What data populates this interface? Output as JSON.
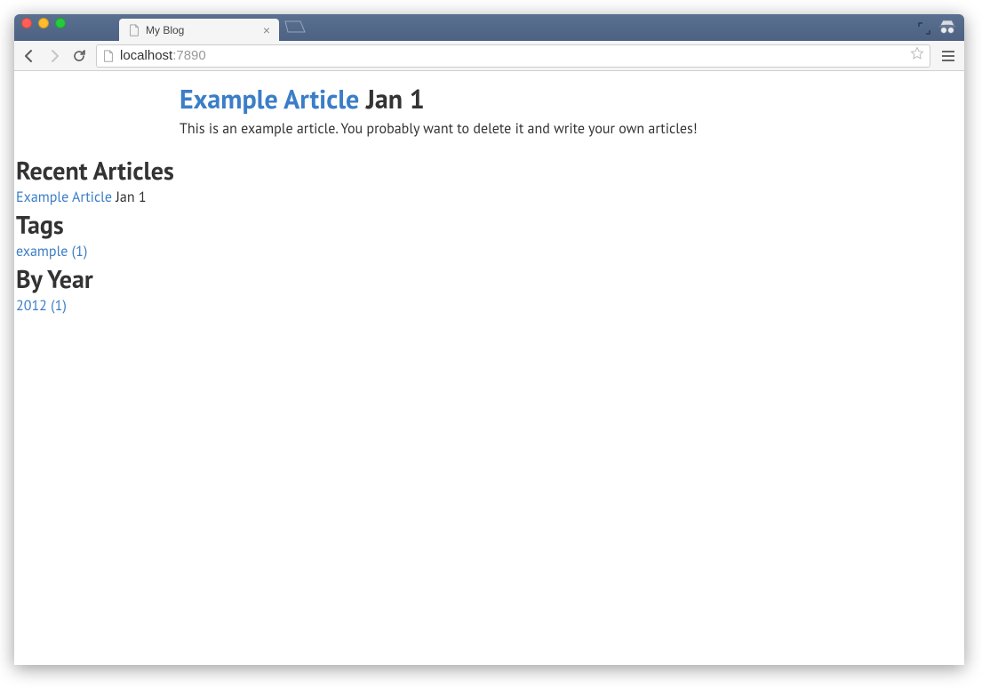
{
  "browser": {
    "tab_title": "My Blog",
    "url_host": "localhost",
    "url_port": ":7890"
  },
  "article": {
    "title": "Example Article",
    "date": "Jan 1",
    "body": "This is an example article. You probably want to delete it and write your own articles!"
  },
  "sidebar": {
    "recent": {
      "heading": "Recent Articles",
      "items": [
        {
          "title": "Example Article",
          "date": "Jan 1"
        }
      ]
    },
    "tags": {
      "heading": "Tags",
      "items": [
        {
          "label": "example (1)"
        }
      ]
    },
    "byyear": {
      "heading": "By Year",
      "items": [
        {
          "label": "2012 (1)"
        }
      ]
    }
  }
}
